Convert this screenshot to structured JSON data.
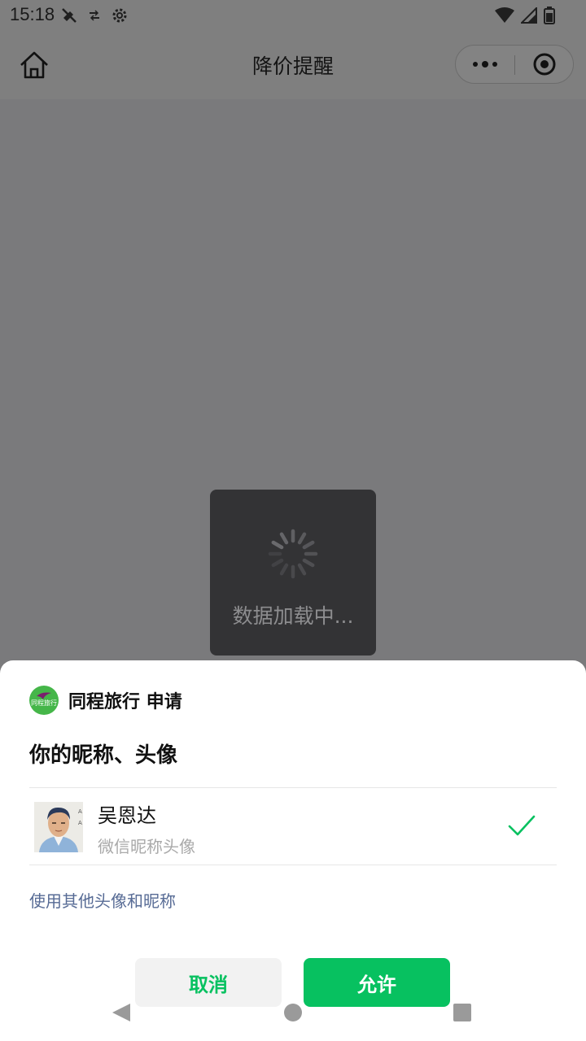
{
  "status_bar": {
    "time": "15:18",
    "left_icons": [
      "no-signal-icon",
      "data-saver-icon",
      "settings-icon"
    ],
    "right_icons": [
      "wifi-icon",
      "cellular-icon",
      "battery-icon"
    ]
  },
  "nav": {
    "title": "降价提醒",
    "home_icon": "home-icon",
    "more_icon": "more-icon",
    "close_icon": "target-close-icon"
  },
  "toast": {
    "text": "数据加载中..."
  },
  "auth_sheet": {
    "app_name": "同程旅行",
    "app_logo_text": "同程旅行",
    "request_suffix": "申请",
    "request_title": "你的昵称、头像",
    "profile": {
      "nickname": "吴恩达",
      "subtitle": "微信昵称头像",
      "selected": true
    },
    "use_other_label": "使用其他头像和昵称",
    "cancel_label": "取消",
    "allow_label": "允许"
  },
  "colors": {
    "accent": "#07c160",
    "link": "#576b95",
    "overlay": "#7a7a7c"
  }
}
